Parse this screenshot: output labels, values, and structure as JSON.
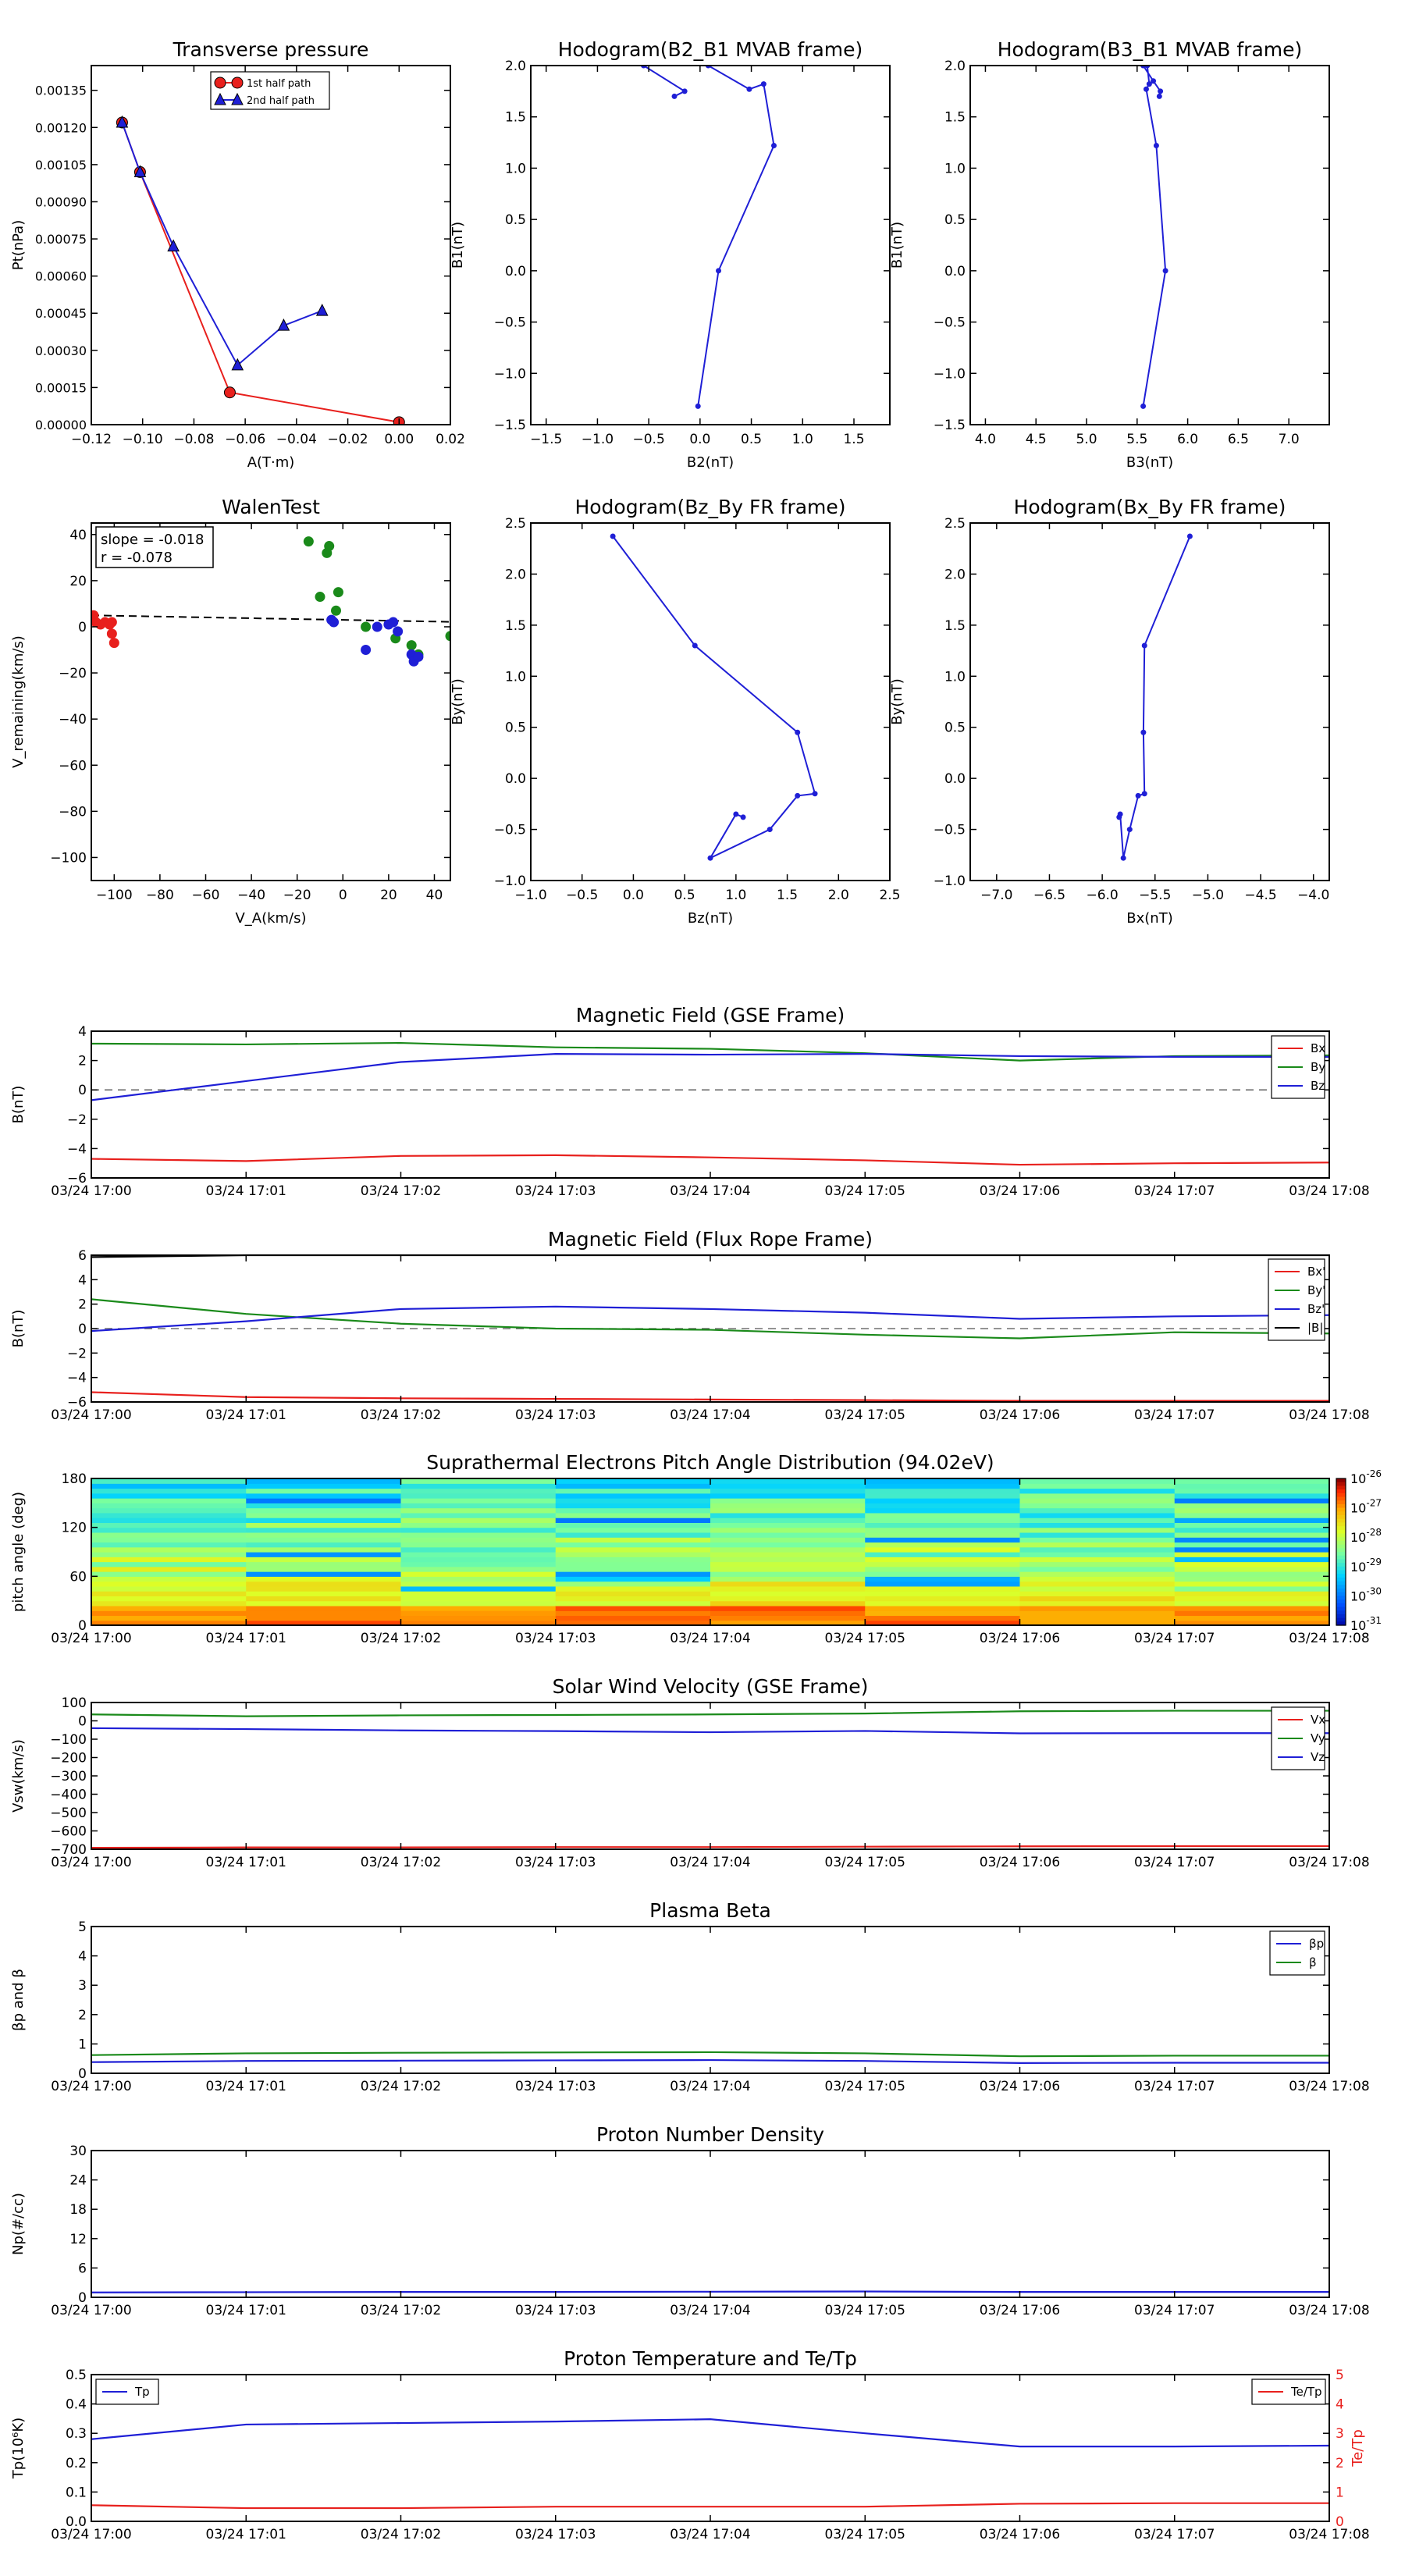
{
  "chart_data": [
    {
      "id": "transverse_pressure",
      "type": "line",
      "title": "Transverse pressure",
      "xlabel": "A(T·m)",
      "ylabel": "Pt(nPa)",
      "xlim": [
        -0.12,
        0.02
      ],
      "ylim": [
        0,
        0.00145
      ],
      "xticks": [
        -0.12,
        -0.1,
        -0.08,
        -0.06,
        -0.04,
        -0.02,
        0,
        0.02
      ],
      "xtick_labels": [
        "−0.12",
        "−0.10",
        "−0.08",
        "−0.06",
        "−0.04",
        "−0.02",
        "0.00",
        "0.02"
      ],
      "yticks": [
        0,
        0.00015,
        0.0003,
        0.00045,
        0.0006,
        0.00075,
        0.0009,
        0.00105,
        0.0012,
        0.00135
      ],
      "ytick_labels": [
        "0.00000",
        "0.00015",
        "0.00030",
        "0.00045",
        "0.00060",
        "0.00075",
        "0.00090",
        "0.00105",
        "0.00120",
        "0.00135"
      ],
      "legend_position": "top-center",
      "series": [
        {
          "name": "1st half path",
          "color": "#e8201d",
          "marker": "circle",
          "x": [
            0.0,
            -0.066,
            -0.101,
            -0.108
          ],
          "y": [
            1e-05,
            0.00013,
            0.00102,
            0.00122
          ]
        },
        {
          "name": "2nd half path",
          "color": "#1f1fd6",
          "marker": "triangle",
          "x": [
            -0.108,
            -0.101,
            -0.088,
            -0.063,
            -0.045,
            -0.03
          ],
          "y": [
            0.00122,
            0.00102,
            0.00072,
            0.00024,
            0.0004,
            0.00046
          ]
        }
      ]
    },
    {
      "id": "hodo_b2_b1",
      "type": "line",
      "title": "Hodogram(B2_B1 MVAB frame)",
      "xlabel": "B2(nT)",
      "ylabel": "B1(nT)",
      "xlim": [
        -1.65,
        1.85
      ],
      "ylim": [
        -1.5,
        2.0
      ],
      "xticks": [
        -1.5,
        -1.0,
        -0.5,
        0,
        0.5,
        1.0,
        1.5
      ],
      "xtick_labels": [
        "−1.5",
        "−1.0",
        "−0.5",
        "0.0",
        "0.5",
        "1.0",
        "1.5"
      ],
      "yticks": [
        -1.5,
        -1.0,
        -0.5,
        0,
        0.5,
        1.0,
        1.5,
        2.0
      ],
      "ytick_labels": [
        "−1.5",
        "−1.0",
        "−0.5",
        "0.0",
        "0.5",
        "1.0",
        "1.5",
        "2.0"
      ],
      "series": [
        {
          "color": "#1f1fd6",
          "marker": "dot",
          "x": [
            -0.02,
            0.18,
            0.72,
            0.62,
            0.48,
            0.08,
            -0.55,
            -0.15,
            -0.25
          ],
          "y": [
            -1.32,
            0.0,
            1.22,
            1.82,
            1.77,
            2.0,
            2.0,
            1.75,
            1.7
          ]
        }
      ]
    },
    {
      "id": "hodo_b3_b1",
      "type": "line",
      "title": "Hodogram(B3_B1 MVAB frame)",
      "xlabel": "B3(nT)",
      "ylabel": "B1(nT)",
      "xlim": [
        3.85,
        7.4
      ],
      "ylim": [
        -1.5,
        2.0
      ],
      "xticks": [
        4.0,
        4.5,
        5.0,
        5.5,
        6.0,
        6.5,
        7.0
      ],
      "xtick_labels": [
        "4.0",
        "4.5",
        "5.0",
        "5.5",
        "6.0",
        "6.5",
        "7.0"
      ],
      "yticks": [
        -1.5,
        -1.0,
        -0.5,
        0,
        0.5,
        1.0,
        1.5,
        2.0
      ],
      "ytick_labels": [
        "−1.5",
        "−1.0",
        "−0.5",
        "0.0",
        "0.5",
        "1.0",
        "1.5",
        "2.0"
      ],
      "series": [
        {
          "color": "#1f1fd6",
          "marker": "dot",
          "x": [
            5.56,
            5.78,
            5.69,
            5.59,
            5.62,
            5.6,
            5.56,
            5.66,
            5.73,
            5.72
          ],
          "y": [
            -1.32,
            0.0,
            1.22,
            1.77,
            1.82,
            2.0,
            2.0,
            1.85,
            1.75,
            1.7
          ]
        }
      ]
    },
    {
      "id": "walen_test",
      "type": "scatter",
      "title": "WalenTest",
      "xlabel": "V_A(km/s)",
      "ylabel": "V_remaining(km/s)",
      "xlim": [
        -110,
        47
      ],
      "ylim": [
        -110,
        45
      ],
      "xticks": [
        -100,
        -80,
        -60,
        -40,
        -20,
        0,
        20,
        40
      ],
      "xtick_labels": [
        "−100",
        "−80",
        "−60",
        "−40",
        "−20",
        "0",
        "20",
        "40"
      ],
      "yticks": [
        -100,
        -80,
        -60,
        -40,
        -20,
        0,
        20,
        40
      ],
      "ytick_labels": [
        "−100",
        "−80",
        "−60",
        "−40",
        "−20",
        "0",
        "20",
        "40"
      ],
      "annotation": [
        "slope = -0.018",
        "r = -0.078"
      ],
      "fit_line": {
        "slope": -0.018,
        "intercept": 3.0,
        "x_range": [
          -110,
          47
        ]
      },
      "series": [
        {
          "color": "#e8201d",
          "x": [
            -109,
            -108,
            -106,
            -104,
            -102,
            -101,
            -100,
            -101
          ],
          "y": [
            5,
            2,
            1,
            2,
            1,
            -3,
            -7,
            2
          ]
        },
        {
          "color": "#1a8a1a",
          "x": [
            -15,
            -6,
            -7,
            -2,
            -3,
            -10,
            10,
            23,
            30,
            33,
            47
          ],
          "y": [
            37,
            35,
            32,
            15,
            7,
            13,
            0,
            -5,
            -8,
            -12,
            -4
          ]
        },
        {
          "color": "#1f1fd6",
          "x": [
            -5,
            -4,
            15,
            20,
            22,
            24,
            10,
            30,
            31,
            33
          ],
          "y": [
            3,
            2,
            0,
            1,
            2,
            -2,
            -10,
            -12,
            -15,
            -13
          ]
        }
      ]
    },
    {
      "id": "hodo_bz_by",
      "type": "line",
      "title": "Hodogram(Bz_By FR frame)",
      "xlabel": "Bz(nT)",
      "ylabel": "By(nT)",
      "xlim": [
        -1.0,
        2.5
      ],
      "ylim": [
        -1.0,
        2.5
      ],
      "xticks": [
        -1.0,
        -0.5,
        0,
        0.5,
        1.0,
        1.5,
        2.0,
        2.5
      ],
      "xtick_labels": [
        "−1.0",
        "−0.5",
        "0.0",
        "0.5",
        "1.0",
        "1.5",
        "2.0",
        "2.5"
      ],
      "yticks": [
        -1.0,
        -0.5,
        0,
        0.5,
        1.0,
        1.5,
        2.0,
        2.5
      ],
      "ytick_labels": [
        "−1.0",
        "−0.5",
        "0.0",
        "0.5",
        "1.0",
        "1.5",
        "2.0",
        "2.5"
      ],
      "series": [
        {
          "color": "#1f1fd6",
          "marker": "dot",
          "x": [
            -0.2,
            0.6,
            1.6,
            1.77,
            1.6,
            1.33,
            0.75,
            1.0,
            1.07
          ],
          "y": [
            2.37,
            1.3,
            0.45,
            -0.15,
            -0.17,
            -0.5,
            -0.78,
            -0.35,
            -0.38
          ]
        }
      ]
    },
    {
      "id": "hodo_bx_by",
      "type": "line",
      "title": "Hodogram(Bx_By FR frame)",
      "xlabel": "Bx(nT)",
      "ylabel": "By(nT)",
      "xlim": [
        -7.25,
        -3.85
      ],
      "ylim": [
        -1.0,
        2.5
      ],
      "xticks": [
        -7.0,
        -6.5,
        -6.0,
        -5.5,
        -5.0,
        -4.5,
        -4.0
      ],
      "xtick_labels": [
        "−7.0",
        "−6.5",
        "−6.0",
        "−5.5",
        "−5.0",
        "−4.5",
        "−4.0"
      ],
      "yticks": [
        -1.0,
        -0.5,
        0,
        0.5,
        1.0,
        1.5,
        2.0,
        2.5
      ],
      "ytick_labels": [
        "−1.0",
        "−0.5",
        "0.0",
        "0.5",
        "1.0",
        "1.5",
        "2.0",
        "2.5"
      ],
      "series": [
        {
          "color": "#1f1fd6",
          "marker": "dot",
          "x": [
            -5.17,
            -5.6,
            -5.61,
            -5.6,
            -5.66,
            -5.74,
            -5.8,
            -5.83,
            -5.84
          ],
          "y": [
            2.37,
            1.3,
            0.45,
            -0.15,
            -0.17,
            -0.5,
            -0.78,
            -0.35,
            -0.38
          ]
        }
      ]
    },
    {
      "id": "mag_gse",
      "type": "line",
      "title": "Magnetic Field (GSE Frame)",
      "xlabel": "",
      "ylabel": "B(nT)",
      "ylim": [
        -6,
        4
      ],
      "yticks": [
        -6,
        -4,
        -2,
        0,
        2,
        4
      ],
      "ytick_labels": [
        "−6",
        "−4",
        "−2",
        "0",
        "2",
        "4"
      ],
      "zero_line": true,
      "legend_position": "top-right",
      "series": [
        {
          "name": "Bx",
          "color": "#e8201d",
          "y": [
            -4.7,
            -4.85,
            -4.5,
            -4.45,
            -4.6,
            -4.8,
            -5.1,
            -5.0,
            -4.95
          ]
        },
        {
          "name": "By",
          "color": "#1a8a1a",
          "y": [
            3.15,
            3.1,
            3.2,
            2.9,
            2.8,
            2.5,
            2.0,
            2.3,
            2.35
          ]
        },
        {
          "name": "Bz",
          "color": "#1f1fd6",
          "y": [
            -0.7,
            0.6,
            1.9,
            2.45,
            2.4,
            2.45,
            2.3,
            2.25,
            2.25
          ]
        }
      ]
    },
    {
      "id": "mag_fr",
      "type": "line",
      "title": "Magnetic Field (Flux Rope Frame)",
      "xlabel": "",
      "ylabel": "B(nT)",
      "ylim": [
        -6,
        6
      ],
      "yticks": [
        -6,
        -4,
        -2,
        0,
        2,
        4,
        6
      ],
      "ytick_labels": [
        "−6",
        "−4",
        "−2",
        "0",
        "2",
        "4",
        "6"
      ],
      "zero_line": true,
      "legend_position": "top-right",
      "series": [
        {
          "name": "Bx'",
          "color": "#e8201d",
          "y": [
            -5.2,
            -5.6,
            -5.7,
            -5.75,
            -5.8,
            -5.85,
            -5.9,
            -5.9,
            -5.9
          ]
        },
        {
          "name": "By'",
          "color": "#1a8a1a",
          "y": [
            2.4,
            1.2,
            0.4,
            0.0,
            -0.1,
            -0.5,
            -0.8,
            -0.3,
            -0.4
          ]
        },
        {
          "name": "Bz'",
          "color": "#1f1fd6",
          "y": [
            -0.2,
            0.6,
            1.6,
            1.8,
            1.6,
            1.3,
            0.8,
            1.0,
            1.1
          ]
        },
        {
          "name": "|B|",
          "color": "#000000",
          "y": [
            5.85,
            6.0,
            6.0,
            6.0,
            6.0,
            6.0,
            6.0,
            6.0,
            6.0
          ]
        }
      ]
    },
    {
      "id": "pad",
      "type": "heatmap",
      "title": "Suprathermal Electrons Pitch Angle Distribution (94.02eV)",
      "xlabel": "",
      "ylabel": "pitch angle (deg)",
      "ylim": [
        0,
        180
      ],
      "yticks": [
        0,
        60,
        120,
        180
      ],
      "ytick_labels": [
        "0",
        "60",
        "120",
        "180"
      ],
      "colorbar_ticks": [
        "-26",
        "-27",
        "-28",
        "-29",
        "-30",
        "-31"
      ],
      "colorbar_base": "10",
      "value_range": [
        0,
        1
      ]
    },
    {
      "id": "vsw",
      "type": "line",
      "title": "Solar Wind Velocity (GSE Frame)",
      "xlabel": "",
      "ylabel": "Vsw(km/s)",
      "ylim": [
        -700,
        100
      ],
      "yticks": [
        -700,
        -600,
        -500,
        -400,
        -300,
        -200,
        -100,
        0,
        100
      ],
      "ytick_labels": [
        "−700",
        "−600",
        "−500",
        "−400",
        "−300",
        "−200",
        "−100",
        "0",
        "100"
      ],
      "legend_position": "top-right",
      "series": [
        {
          "name": "Vx",
          "color": "#e8201d",
          "y": [
            -692,
            -690,
            -690,
            -688,
            -688,
            -686,
            -684,
            -683,
            -683
          ]
        },
        {
          "name": "Vy",
          "color": "#1a8a1a",
          "y": [
            35,
            25,
            30,
            32,
            35,
            40,
            52,
            55,
            55
          ]
        },
        {
          "name": "Vz",
          "color": "#1f1fd6",
          "y": [
            -40,
            -45,
            -52,
            -56,
            -62,
            -55,
            -68,
            -67,
            -67
          ]
        }
      ]
    },
    {
      "id": "beta",
      "type": "line",
      "title": "Plasma Beta",
      "xlabel": "",
      "ylabel": "βp and β",
      "ylim": [
        0,
        5
      ],
      "yticks": [
        0,
        1,
        2,
        3,
        4,
        5
      ],
      "ytick_labels": [
        "0",
        "1",
        "2",
        "3",
        "4",
        "5"
      ],
      "legend_position": "top-right",
      "series": [
        {
          "name": "βp",
          "color": "#1f1fd6",
          "y": [
            0.38,
            0.42,
            0.43,
            0.44,
            0.45,
            0.42,
            0.35,
            0.36,
            0.36
          ]
        },
        {
          "name": "β",
          "color": "#1a8a1a",
          "y": [
            0.62,
            0.68,
            0.7,
            0.71,
            0.72,
            0.68,
            0.58,
            0.6,
            0.6
          ]
        }
      ]
    },
    {
      "id": "np",
      "type": "line",
      "title": "Proton Number Density",
      "xlabel": "",
      "ylabel": "Np(#/cc)",
      "ylim": [
        0,
        30
      ],
      "yticks": [
        0,
        6,
        12,
        18,
        24,
        30
      ],
      "ytick_labels": [
        "0",
        "6",
        "12",
        "18",
        "24",
        "30"
      ],
      "series": [
        {
          "name": "Np",
          "color": "#1f1fd6",
          "y": [
            1.0,
            1.05,
            1.1,
            1.1,
            1.15,
            1.2,
            1.1,
            1.1,
            1.1
          ]
        }
      ]
    },
    {
      "id": "tp",
      "type": "line",
      "title": "Proton Temperature and Te/Tp",
      "xlabel": "",
      "ylabel": "Tp(10⁶K)",
      "ylim": [
        0,
        0.5
      ],
      "yticks": [
        0,
        0.1,
        0.2,
        0.3,
        0.4,
        0.5
      ],
      "ytick_labels": [
        "0.0",
        "0.1",
        "0.2",
        "0.3",
        "0.4",
        "0.5"
      ],
      "y2lim": [
        0,
        5
      ],
      "y2ticks": [
        0,
        1,
        2,
        3,
        4,
        5
      ],
      "y2tick_labels": [
        "0",
        "1",
        "2",
        "3",
        "4",
        "5"
      ],
      "y2label": "Te/Tp",
      "series": [
        {
          "name": "Tp",
          "color": "#1f1fd6",
          "axis": "left",
          "y": [
            0.28,
            0.33,
            0.335,
            0.34,
            0.348,
            0.3,
            0.255,
            0.255,
            0.258
          ]
        },
        {
          "name": "Te/Tp",
          "color": "#e8201d",
          "axis": "right",
          "y": [
            0.55,
            0.45,
            0.45,
            0.5,
            0.5,
            0.5,
            0.6,
            0.62,
            0.62
          ]
        }
      ]
    }
  ],
  "time_axis": {
    "tick_labels": [
      "03/24 17:00",
      "03/24 17:01",
      "03/24 17:02",
      "03/24 17:03",
      "03/24 17:04",
      "03/24 17:05",
      "03/24 17:06",
      "03/24 17:07",
      "03/24 17:08"
    ]
  },
  "colors": {
    "red": "#e8201d",
    "green": "#1a8a1a",
    "blue": "#1f1fd6"
  }
}
